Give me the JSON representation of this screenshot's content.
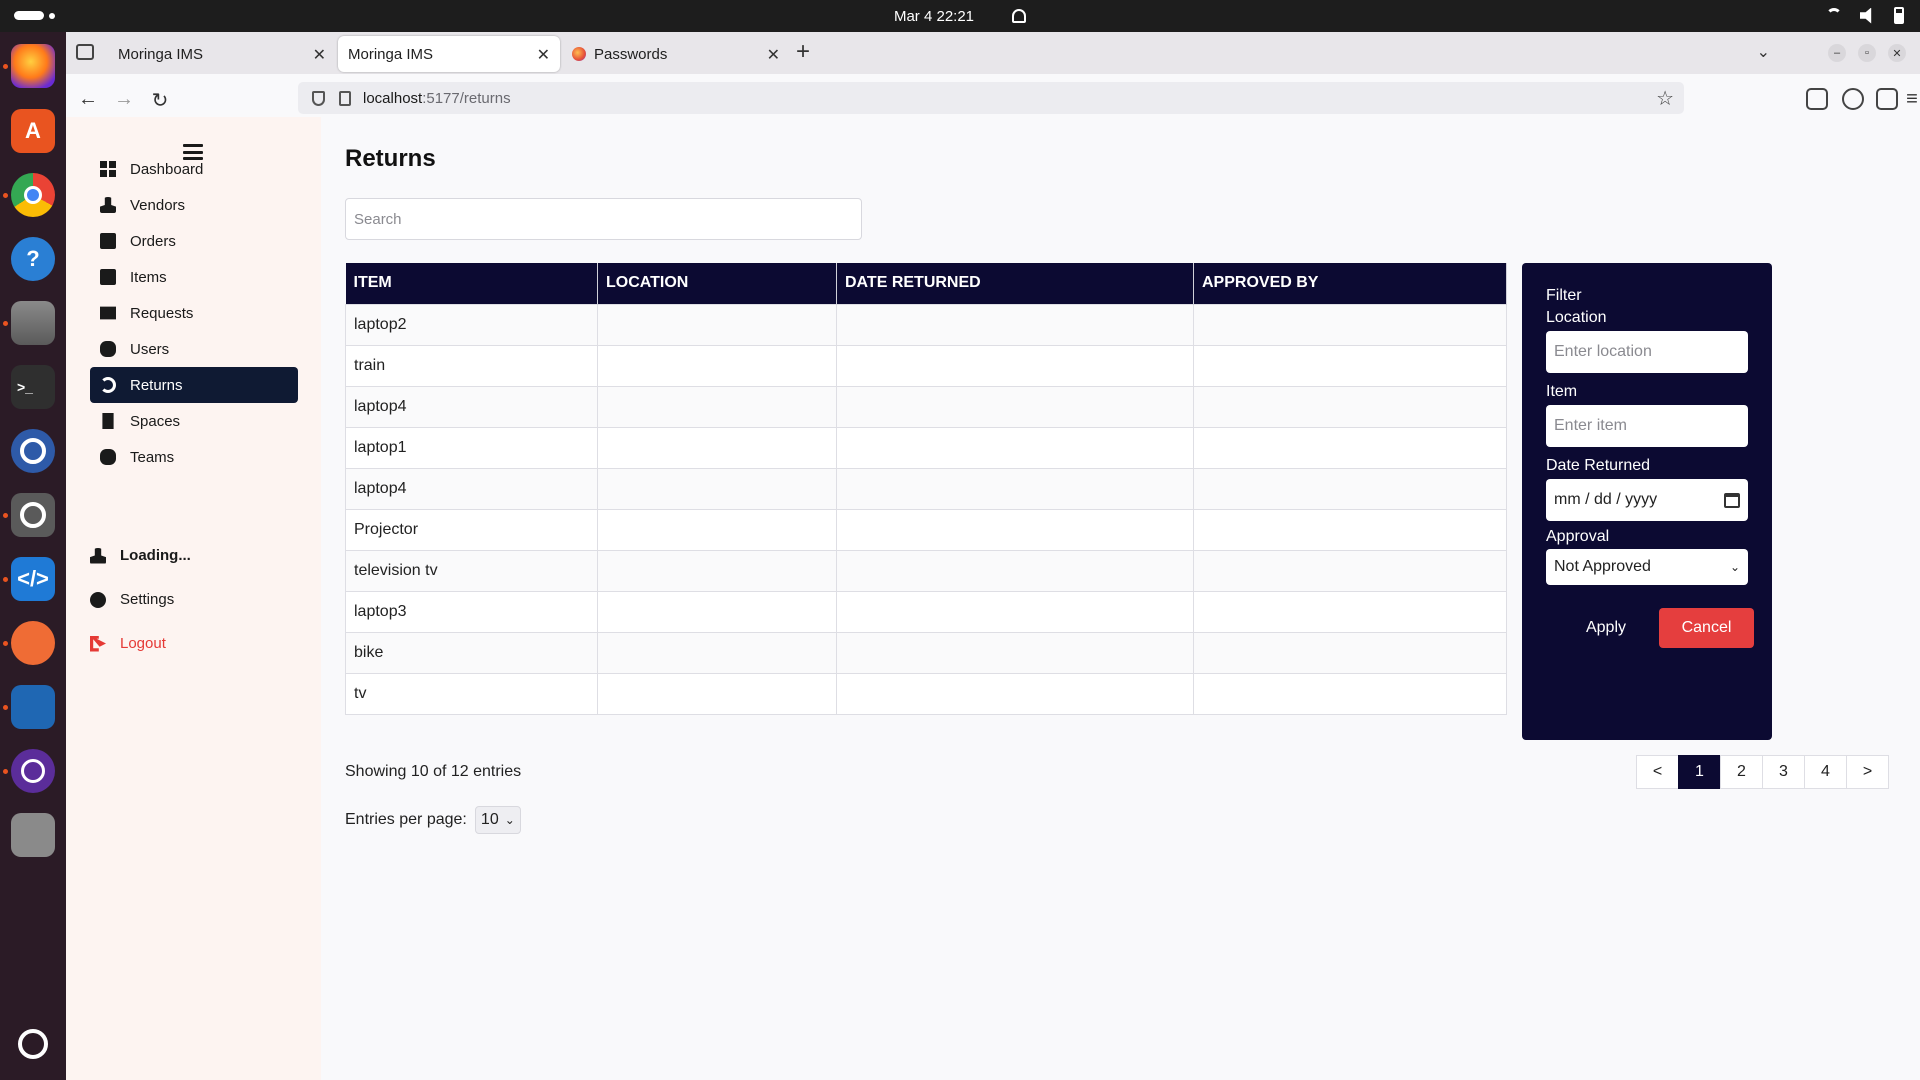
{
  "os": {
    "clock": "Mar 4  22:21"
  },
  "dock": {
    "apps": [
      {
        "name": "firefox-icon",
        "color": "#e66000"
      },
      {
        "name": "app-center-icon",
        "color": "#e95420"
      },
      {
        "name": "chrome-icon",
        "color": "#4285f4"
      },
      {
        "name": "help-icon",
        "color": "#2a7fd4"
      },
      {
        "name": "files-icon",
        "color": "#6b6b6b"
      },
      {
        "name": "terminal-icon",
        "color": "#333333"
      },
      {
        "name": "timer-icon",
        "color": "#2e5aa8"
      },
      {
        "name": "magnifier-icon",
        "color": "#5a5a5a"
      },
      {
        "name": "vscode-icon",
        "color": "#1f7ad6"
      },
      {
        "name": "postman-icon",
        "color": "#ef6c35"
      },
      {
        "name": "writer-icon",
        "color": "#1f67b3"
      },
      {
        "name": "screen-recorder-icon",
        "color": "#5b2d9a"
      },
      {
        "name": "trash-icon",
        "color": "#6d6d6d"
      },
      {
        "name": "show-apps-icon",
        "color": "#2b1b26"
      }
    ]
  },
  "browser": {
    "tabs": [
      {
        "label": "Moringa IMS"
      },
      {
        "label": "Moringa IMS"
      },
      {
        "label": "Passwords"
      }
    ],
    "url_host": "localhost",
    "url_path": ":5177/returns"
  },
  "sidebar": {
    "items": [
      {
        "label": "Dashboard"
      },
      {
        "label": "Vendors"
      },
      {
        "label": "Orders"
      },
      {
        "label": "Items"
      },
      {
        "label": "Requests"
      },
      {
        "label": "Users"
      },
      {
        "label": "Returns"
      },
      {
        "label": "Spaces"
      },
      {
        "label": "Teams"
      }
    ],
    "user_status": "Loading...",
    "settings": "Settings",
    "logout": "Logout"
  },
  "main": {
    "title": "Returns",
    "search_placeholder": "Search",
    "table": {
      "headers": [
        "ITEM",
        "LOCATION",
        "DATE RETURNED",
        "APPROVED BY"
      ],
      "rows": [
        {
          "item": "laptop2"
        },
        {
          "item": "train"
        },
        {
          "item": "laptop4"
        },
        {
          "item": "laptop1"
        },
        {
          "item": "laptop4"
        },
        {
          "item": "Projector"
        },
        {
          "item": "television tv"
        },
        {
          "item": "laptop3"
        },
        {
          "item": "bike"
        },
        {
          "item": "tv"
        }
      ]
    },
    "showing": "Showing 10 of 12 entries",
    "entries_label": "Entries per page:",
    "entries_value": "10",
    "pagination": {
      "prev": "<",
      "pages": [
        "1",
        "2",
        "3",
        "4"
      ],
      "next": ">"
    }
  },
  "filter": {
    "title": "Filter",
    "location_label": "Location",
    "location_placeholder": "Enter location",
    "item_label": "Item",
    "item_placeholder": "Enter item",
    "date_label": "Date Returned",
    "date_placeholder": "mm / dd / yyyy",
    "approval_label": "Approval",
    "approval_value": "Not Approved",
    "apply": "Apply",
    "cancel": "Cancel"
  }
}
